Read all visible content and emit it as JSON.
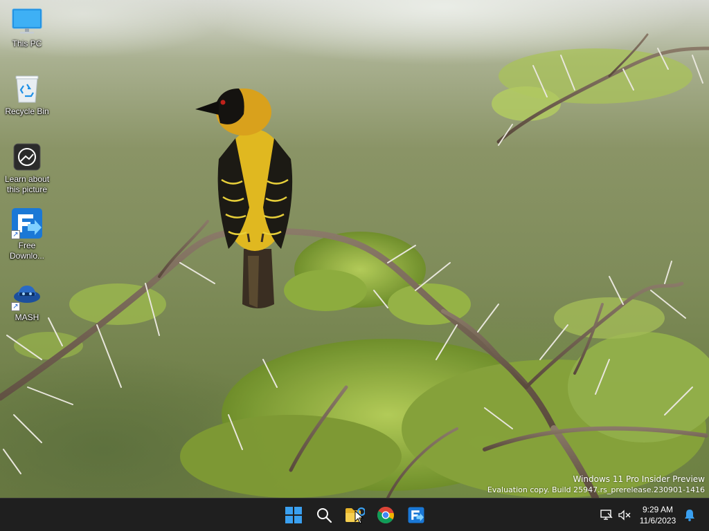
{
  "desktop": {
    "icons": [
      {
        "label": "This PC",
        "icon": "monitor-icon"
      },
      {
        "label": "Recycle Bin",
        "icon": "recycle-bin-icon"
      },
      {
        "label": "Learn about this picture",
        "icon": "learn-picture-icon"
      },
      {
        "label": "Free Downlo...",
        "icon": "free-download-manager-icon"
      },
      {
        "label": "MASH",
        "icon": "mash-icon"
      }
    ]
  },
  "watermark": {
    "line1": "Windows 11 Pro Insider Preview",
    "line2": "Evaluation copy. Build 25947.rs_prerelease.230901-1416"
  },
  "taskbar": {
    "pinned": [
      {
        "name": "start",
        "icon": "windows-logo-icon"
      },
      {
        "name": "search",
        "icon": "search-icon"
      },
      {
        "name": "file-explorer",
        "icon": "folder-icon"
      },
      {
        "name": "chrome",
        "icon": "chrome-icon"
      },
      {
        "name": "free-download-manager",
        "icon": "fdm-icon"
      }
    ],
    "clock": {
      "time": "9:29 AM",
      "date": "11/6/2023"
    },
    "colors": {
      "background": "#1f1f1f",
      "accent": "#3aa0f0"
    }
  }
}
